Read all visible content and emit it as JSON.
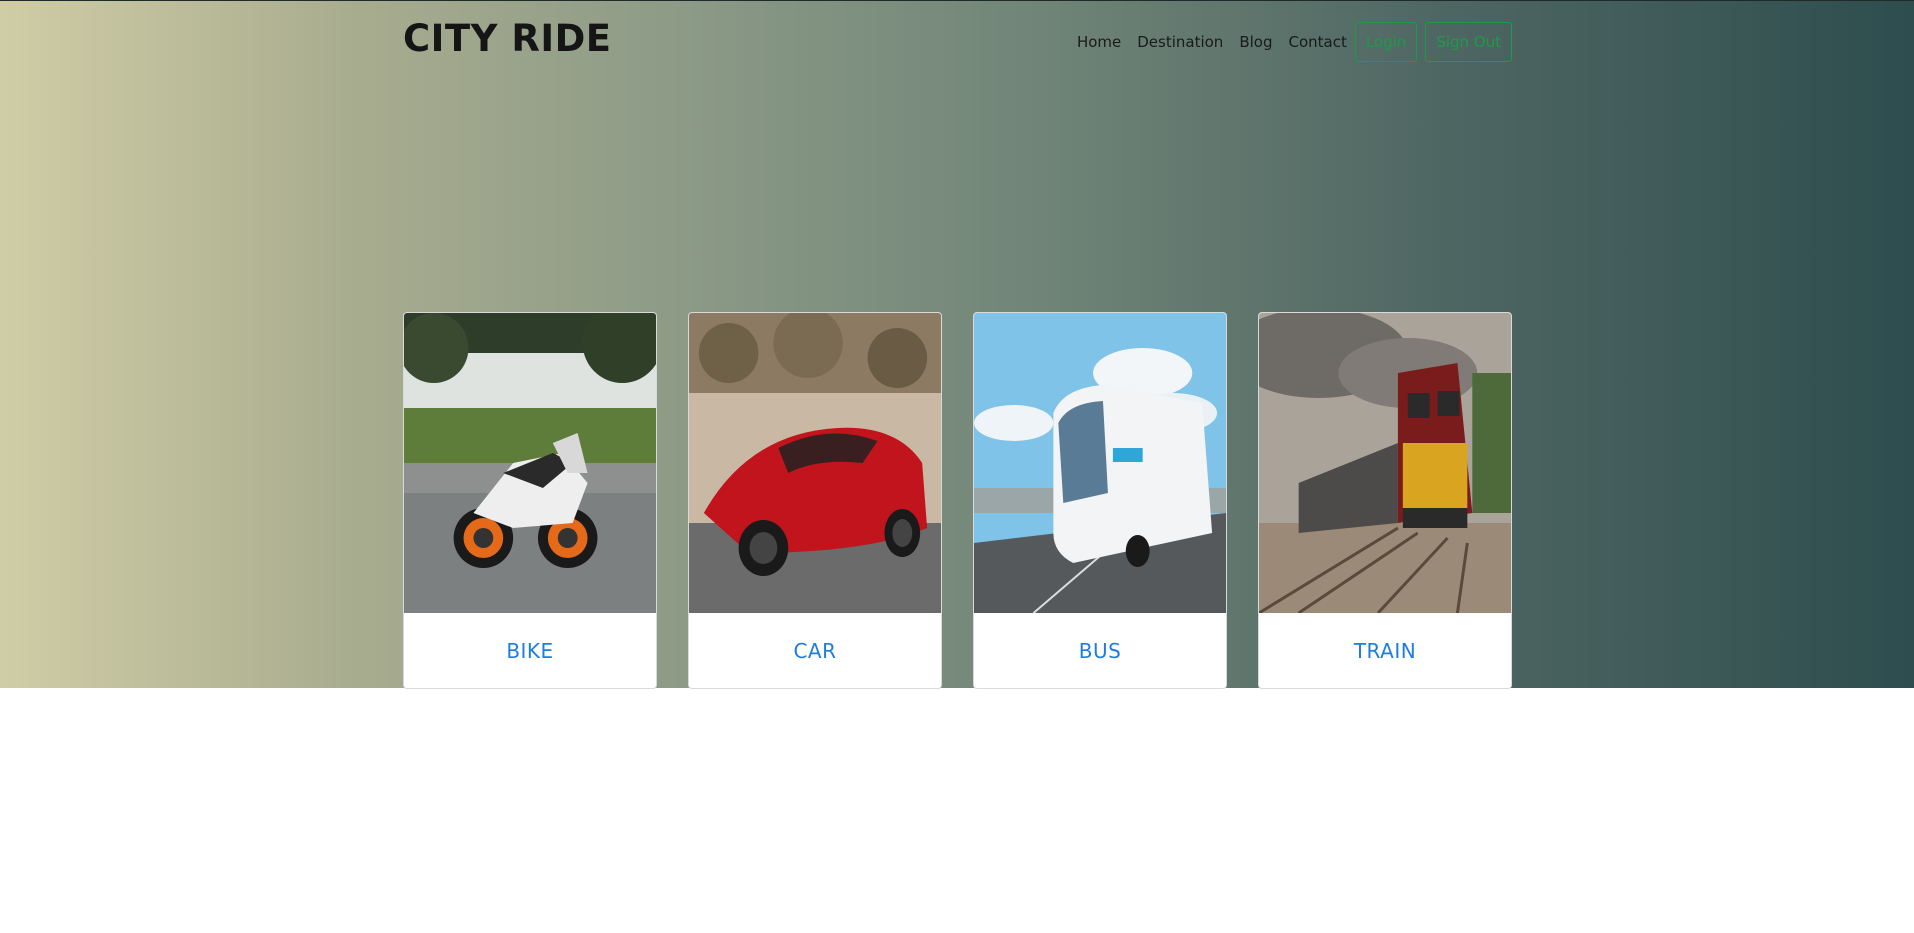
{
  "brand": {
    "title": "CITY RIDE"
  },
  "nav": {
    "links": [
      "Home",
      "Destination",
      "Blog",
      "Contact"
    ],
    "login_label": "Login",
    "signout_label": "Sign Out"
  },
  "cards": [
    {
      "label": "BIKE",
      "image": "motorcycle-photo"
    },
    {
      "label": "CAR",
      "image": "sports-car-photo"
    },
    {
      "label": "BUS",
      "image": "coach-bus-photo"
    },
    {
      "label": "TRAIN",
      "image": "freight-train-photo"
    }
  ],
  "colors": {
    "accent_link": "#1f7de0",
    "button_green": "#1e9a4a",
    "gradient_start": "#d0cda6",
    "gradient_end": "#2e4d4e"
  }
}
